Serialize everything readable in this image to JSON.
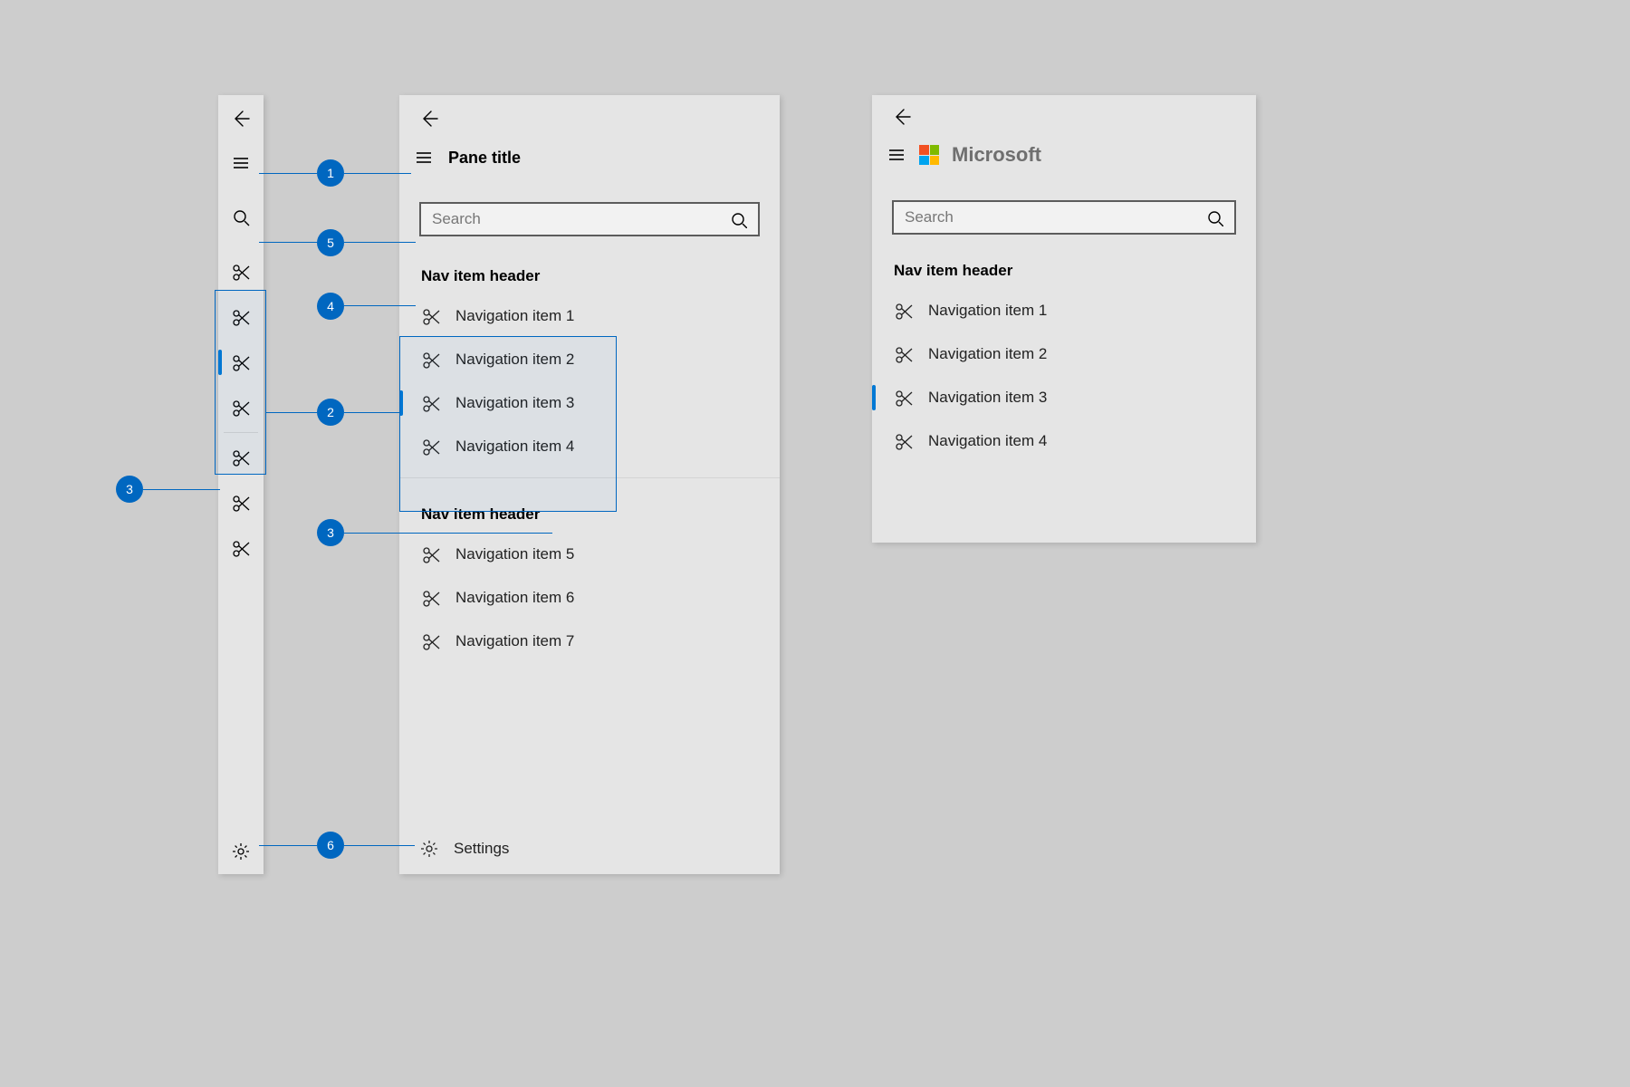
{
  "compact": {
    "back_icon": "arrow-left",
    "hamburger_icon": "hamburger",
    "search_icon": "search",
    "group1_items": [
      {
        "icon": "scissors-icon"
      },
      {
        "icon": "scissors-icon"
      },
      {
        "icon": "scissors-icon",
        "selected": true
      },
      {
        "icon": "scissors-icon"
      }
    ],
    "group2_items": [
      {
        "icon": "scissors-icon"
      },
      {
        "icon": "scissors-icon"
      },
      {
        "icon": "scissors-icon"
      }
    ],
    "settings_icon": "gear"
  },
  "expanded": {
    "back_icon": "arrow-left",
    "pane_title": "Pane title",
    "search_placeholder": "Search",
    "header1": "Nav item header",
    "group1_items": [
      {
        "label": "Navigation item 1"
      },
      {
        "label": "Navigation item 2"
      },
      {
        "label": "Navigation item 3",
        "selected": true
      },
      {
        "label": "Navigation item 4"
      }
    ],
    "header2": "Nav item header",
    "group2_items": [
      {
        "label": "Navigation item 5"
      },
      {
        "label": "Navigation item 6"
      },
      {
        "label": "Navigation item 7"
      }
    ],
    "settings_label": "Settings"
  },
  "branded": {
    "brand_name": "Microsoft",
    "search_placeholder": "Search",
    "header": "Nav item header",
    "items": [
      {
        "label": "Navigation item 1"
      },
      {
        "label": "Navigation item 2"
      },
      {
        "label": "Navigation item 3",
        "selected": true
      },
      {
        "label": "Navigation item 4"
      }
    ]
  },
  "callouts": {
    "1": "1",
    "2": "2",
    "3": "3",
    "4": "4",
    "5": "5",
    "6": "6"
  }
}
